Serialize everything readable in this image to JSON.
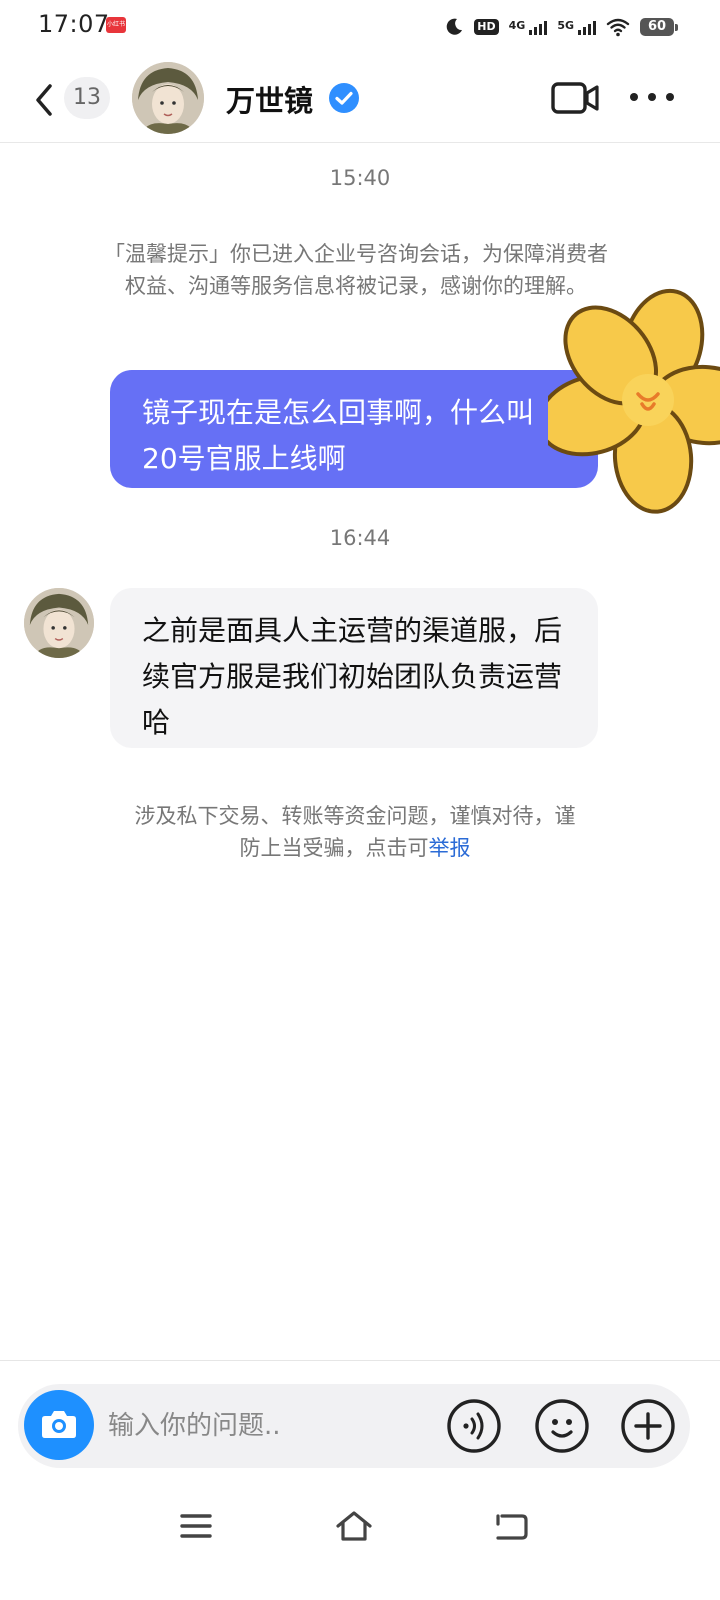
{
  "status_bar": {
    "time": "17:07",
    "notification_badge": "小红书",
    "network_1": "4G",
    "network_2": "5G",
    "hd_label": "HD",
    "battery": "60"
  },
  "header": {
    "unread_count": "13",
    "contact_name": "万世镜",
    "icons": {
      "back": "chevron-left-icon",
      "verified": "verified-check-icon",
      "video": "video-camera-icon",
      "more": "more-dots-icon"
    },
    "colors": {
      "verified": "#2f8fff"
    }
  },
  "chat": {
    "timestamp_1": "15:40",
    "system_notice": "「温馨提示」你已进入企业号咨询会话，为保障消费者权益、沟通等服务信息将被记录，感谢你的理解。",
    "outgoing_message": "镜子现在是怎么回事啊，什么叫20号官服上线啊",
    "timestamp_2": "16:44",
    "incoming_message": "之前是面具人主运营的渠道服，后续官方服是我们初始团队负责运营哈",
    "safety_notice": "涉及私下交易、转账等资金问题，谨慎对待，谨防上当受骗，点击可",
    "report_link": "举报",
    "colors": {
      "outgoing_bubble": "#6670f5",
      "incoming_bubble": "#f4f4f6",
      "report_link": "#2b6bd6"
    }
  },
  "input_bar": {
    "placeholder": "输入你的问题..",
    "icons": {
      "camera": "camera-icon",
      "voice": "voice-icon",
      "emoji": "emoji-icon",
      "plus": "plus-icon"
    },
    "colors": {
      "camera": "#1e90ff"
    }
  },
  "nav_bar": {
    "icons": {
      "menu": "menu-icon",
      "home": "home-icon",
      "back": "back-icon"
    }
  }
}
